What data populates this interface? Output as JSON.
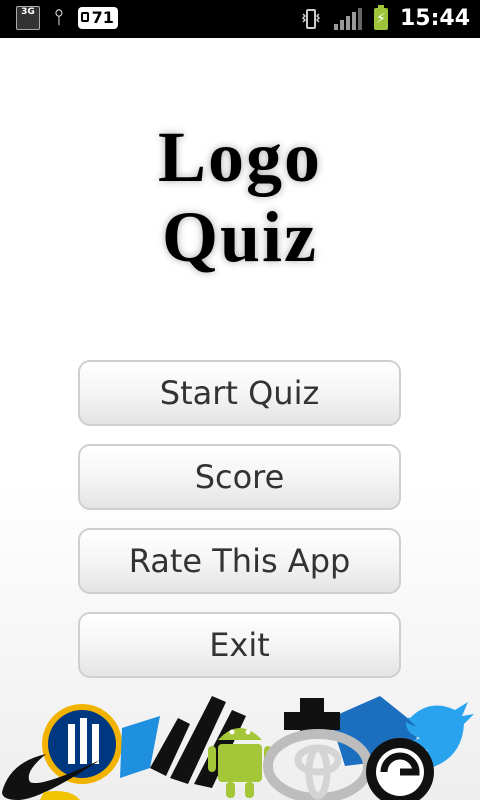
{
  "status_bar": {
    "network_type": "3G",
    "notification_count": "71",
    "time": "15:44",
    "icons": [
      "3g-data-icon",
      "usb-icon",
      "notification-count-icon",
      "vibrate-icon",
      "signal-icon",
      "battery-charging-icon"
    ]
  },
  "title": {
    "line1": "Logo",
    "line2": "Quiz"
  },
  "menu": {
    "start_label": "Start Quiz",
    "score_label": "Score",
    "rate_label": "Rate This App",
    "exit_label": "Exit"
  },
  "logo_strip": {
    "icons": [
      "nike-swoosh-icon",
      "allianz-logo-icon",
      "adidas-stripes-icon",
      "android-robot-icon",
      "toyota-logo-icon",
      "blue-brand-logo-icon",
      "twitter-bird-icon"
    ],
    "colors": {
      "allianz_blue": "#003781",
      "android_green": "#a4c639",
      "twitter_blue": "#2aa3ef",
      "dark": "#111111",
      "silver": "#bdbdbd"
    }
  }
}
